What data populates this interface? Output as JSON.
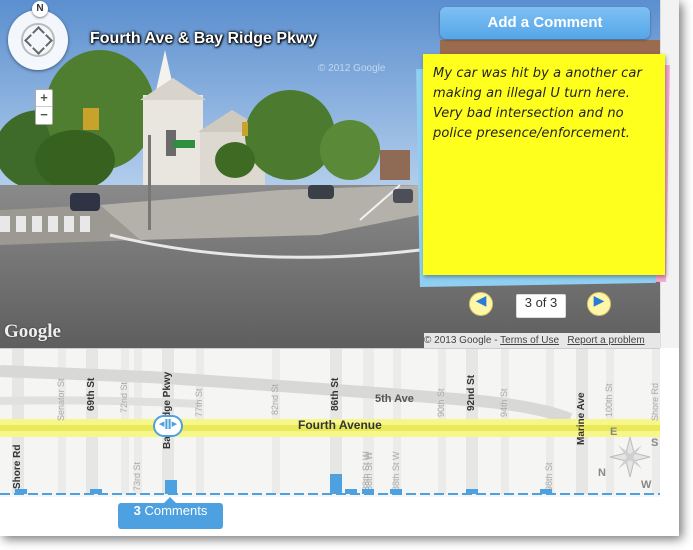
{
  "streetview": {
    "location_title": "Fourth Ave & Bay Ridge Pkwy",
    "watermark": "© 2012 Google",
    "compass_north": "N",
    "zoom_in": "+",
    "zoom_out": "−",
    "google_logo": "Google",
    "footer": {
      "copyright": "© 2013 Google",
      "separator": " - ",
      "terms": "Terms of Use",
      "report": "Report a problem"
    }
  },
  "comments_panel": {
    "add_button": "Add a Comment",
    "note_text": "My car was hit by a another car making an illegal U turn here. Very bad intersection and no police presence/enforcement.",
    "prev_icon": "◀",
    "next_icon": "▶",
    "page_indicator": "3 of 3",
    "note_color": "#ffff1e",
    "back_note_colors": [
      "#f7a8d4",
      "#8fd0f2"
    ]
  },
  "map": {
    "avenue_label": "Fourth Avenue",
    "avenue2_label": "5th Ave",
    "streets_dark": [
      {
        "name": "Shore Rd"
      },
      {
        "name": "69th St"
      },
      {
        "name": "Bay Ridge Pkwy"
      },
      {
        "name": "86th St"
      },
      {
        "name": "92nd St"
      },
      {
        "name": "Marine Ave"
      }
    ],
    "streets_light": [
      {
        "name": "Senator St"
      },
      {
        "name": "72nd St"
      },
      {
        "name": "73rd St"
      },
      {
        "name": "77th St"
      },
      {
        "name": "82nd St"
      },
      {
        "name": "88th St W"
      },
      {
        "name": "88th St W"
      },
      {
        "name": "88th St W"
      },
      {
        "name": "90th St"
      },
      {
        "name": "94th St"
      },
      {
        "name": "98th St"
      },
      {
        "name": "100th St"
      },
      {
        "name": "Shore Rd"
      }
    ],
    "compass": {
      "N": "N",
      "E": "E",
      "S": "S",
      "W": "W"
    },
    "comment_counts_label_num": "3",
    "comment_counts_label_word": " Comments",
    "accent": "#4ea1e0",
    "avenue_highlight": "#f6f68a"
  }
}
